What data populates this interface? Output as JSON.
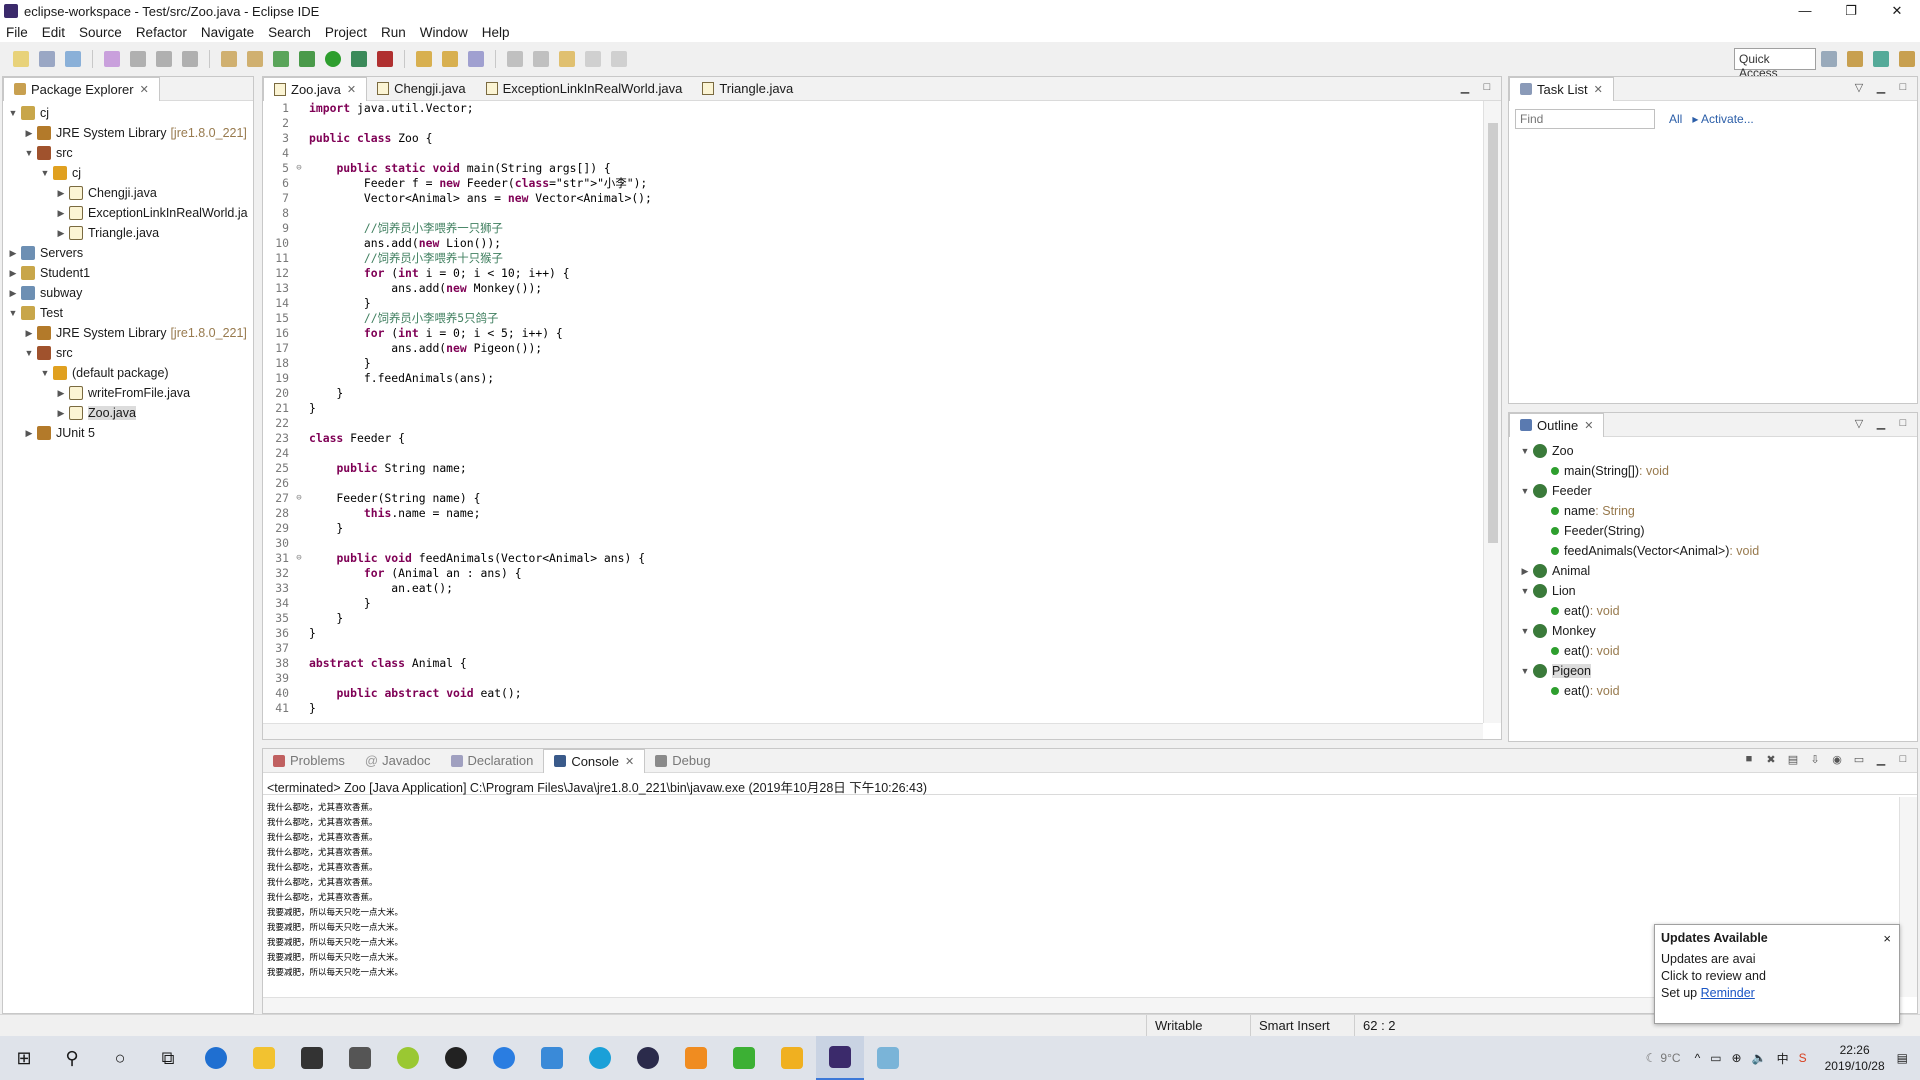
{
  "window": {
    "title": "eclipse-workspace - Test/src/Zoo.java - Eclipse IDE",
    "minimize": "—",
    "maximize": "❐",
    "close": "✕"
  },
  "menu": [
    "File",
    "Edit",
    "Source",
    "Refactor",
    "Navigate",
    "Search",
    "Project",
    "Run",
    "Window",
    "Help"
  ],
  "toolbar": {
    "quick_access": "Quick Access"
  },
  "package_explorer": {
    "tab_label": "Package Explorer",
    "tree": [
      {
        "label": "cj",
        "icon": "project-icon",
        "depth": 0,
        "expanded": true
      },
      {
        "label": "JRE System Library",
        "suffix": "[jre1.8.0_221]",
        "icon": "library-icon",
        "depth": 1,
        "expanded": false
      },
      {
        "label": "src",
        "icon": "source-folder-icon",
        "depth": 1,
        "expanded": true
      },
      {
        "label": "cj",
        "icon": "package-icon",
        "depth": 2,
        "expanded": true
      },
      {
        "label": "Chengji.java",
        "icon": "java-file-icon",
        "depth": 3,
        "expanded": false
      },
      {
        "label": "ExceptionLinkInRealWorld.ja",
        "icon": "java-file-icon",
        "depth": 3,
        "expanded": false
      },
      {
        "label": "Triangle.java",
        "icon": "java-file-icon",
        "depth": 3,
        "expanded": false
      },
      {
        "label": "Servers",
        "icon": "folder-icon",
        "depth": 0,
        "expanded": false
      },
      {
        "label": "Student1",
        "icon": "project-icon",
        "depth": 0,
        "expanded": false
      },
      {
        "label": "subway",
        "icon": "folder-icon",
        "depth": 0,
        "expanded": false
      },
      {
        "label": "Test",
        "icon": "project-icon",
        "depth": 0,
        "expanded": true
      },
      {
        "label": "JRE System Library",
        "suffix": "[jre1.8.0_221]",
        "icon": "library-icon",
        "depth": 1,
        "expanded": false
      },
      {
        "label": "src",
        "icon": "source-folder-icon",
        "depth": 1,
        "expanded": true
      },
      {
        "label": "(default package)",
        "icon": "package-icon",
        "depth": 2,
        "expanded": true
      },
      {
        "label": "writeFromFile.java",
        "icon": "java-file-icon",
        "depth": 3,
        "expanded": false
      },
      {
        "label": "Zoo.java",
        "icon": "java-file-icon",
        "depth": 3,
        "expanded": false,
        "selected": true
      },
      {
        "label": "JUnit 5",
        "icon": "library-icon",
        "depth": 1,
        "expanded": false
      }
    ]
  },
  "editor": {
    "tabs": [
      "Zoo.java",
      "Chengji.java",
      "ExceptionLinkInRealWorld.java",
      "Triangle.java"
    ],
    "active_tab": 0,
    "lines": [
      "import java.util.Vector;",
      "",
      "public class Zoo {",
      "",
      "    public static void main(String args[]) {",
      "        Feeder f = new Feeder(\"小李\");",
      "        Vector<Animal> ans = new Vector<Animal>();",
      "",
      "        //饲养员小李喂养一只狮子",
      "        ans.add(new Lion());",
      "        //饲养员小李喂养十只猴子",
      "        for (int i = 0; i < 10; i++) {",
      "            ans.add(new Monkey());",
      "        }",
      "        //饲养员小李喂养5只鸽子",
      "        for (int i = 0; i < 5; i++) {",
      "            ans.add(new Pigeon());",
      "        }",
      "        f.feedAnimals(ans);",
      "    }",
      "}",
      "",
      "class Feeder {",
      "",
      "    public String name;",
      "",
      "    Feeder(String name) {",
      "        this.name = name;",
      "    }",
      "",
      "    public void feedAnimals(Vector<Animal> ans) {",
      "        for (Animal an : ans) {",
      "            an.eat();",
      "        }",
      "    }",
      "}",
      "",
      "abstract class Animal {",
      "",
      "    public abstract void eat();",
      "}"
    ],
    "fold_markers": {
      "5": "⊖",
      "27": "⊖",
      "31": "⊖"
    }
  },
  "task_list": {
    "tab_label": "Task List",
    "find_placeholder": "Find",
    "all_label": "All",
    "activate_label": "Activate..."
  },
  "outline": {
    "tab_label": "Outline",
    "items": [
      {
        "name": "Zoo",
        "ret": "",
        "kind": "class",
        "depth": 0,
        "expanded": true
      },
      {
        "name": "main(String[])",
        "ret": " : void",
        "kind": "method-static",
        "depth": 1
      },
      {
        "name": "Feeder",
        "ret": "",
        "kind": "class",
        "depth": 0,
        "expanded": true
      },
      {
        "name": "name",
        "ret": " : String",
        "kind": "field",
        "depth": 1
      },
      {
        "name": "Feeder(String)",
        "ret": "",
        "kind": "constructor",
        "depth": 1
      },
      {
        "name": "feedAnimals(Vector<Animal>)",
        "ret": " : void",
        "kind": "method",
        "depth": 1
      },
      {
        "name": "Animal",
        "ret": "",
        "kind": "class-abstract",
        "depth": 0,
        "expanded": false
      },
      {
        "name": "Lion",
        "ret": "",
        "kind": "class",
        "depth": 0,
        "expanded": true
      },
      {
        "name": "eat()",
        "ret": " : void",
        "kind": "method",
        "depth": 1
      },
      {
        "name": "Monkey",
        "ret": "",
        "kind": "class",
        "depth": 0,
        "expanded": true
      },
      {
        "name": "eat()",
        "ret": " : void",
        "kind": "method",
        "depth": 1
      },
      {
        "name": "Pigeon",
        "ret": "",
        "kind": "class",
        "depth": 0,
        "expanded": true,
        "selected": true
      },
      {
        "name": "eat()",
        "ret": " : void",
        "kind": "method",
        "depth": 1
      }
    ]
  },
  "console": {
    "tabs": [
      "Problems",
      "Javadoc",
      "Declaration",
      "Console",
      "Debug"
    ],
    "active_tab": 3,
    "header": "<terminated> Zoo [Java Application] C:\\Program Files\\Java\\jre1.8.0_221\\bin\\javaw.exe (2019年10月28日 下午10:26:43)",
    "lines": [
      "我什么都吃，尤其喜欢香蕉。",
      "我什么都吃，尤其喜欢香蕉。",
      "我什么都吃，尤其喜欢香蕉。",
      "我什么都吃，尤其喜欢香蕉。",
      "我什么都吃，尤其喜欢香蕉。",
      "我什么都吃，尤其喜欢香蕉。",
      "我什么都吃，尤其喜欢香蕉。",
      "我要减肥，所以每天只吃一点大米。",
      "我要减肥，所以每天只吃一点大米。",
      "我要减肥，所以每天只吃一点大米。",
      "我要减肥，所以每天只吃一点大米。",
      "我要减肥，所以每天只吃一点大米。"
    ]
  },
  "status": {
    "writable": "Writable",
    "insert_mode": "Smart Insert",
    "position": "62 : 2"
  },
  "updates_popup": {
    "title": "Updates Available",
    "line1": "Updates are avai",
    "line2": "Click to review and",
    "setup": "Set up",
    "link": "Reminder",
    "close": "×"
  },
  "taskbar": {
    "time": "22:26",
    "date": "2019/10/28",
    "weather": "9°C",
    "ime": "中"
  }
}
